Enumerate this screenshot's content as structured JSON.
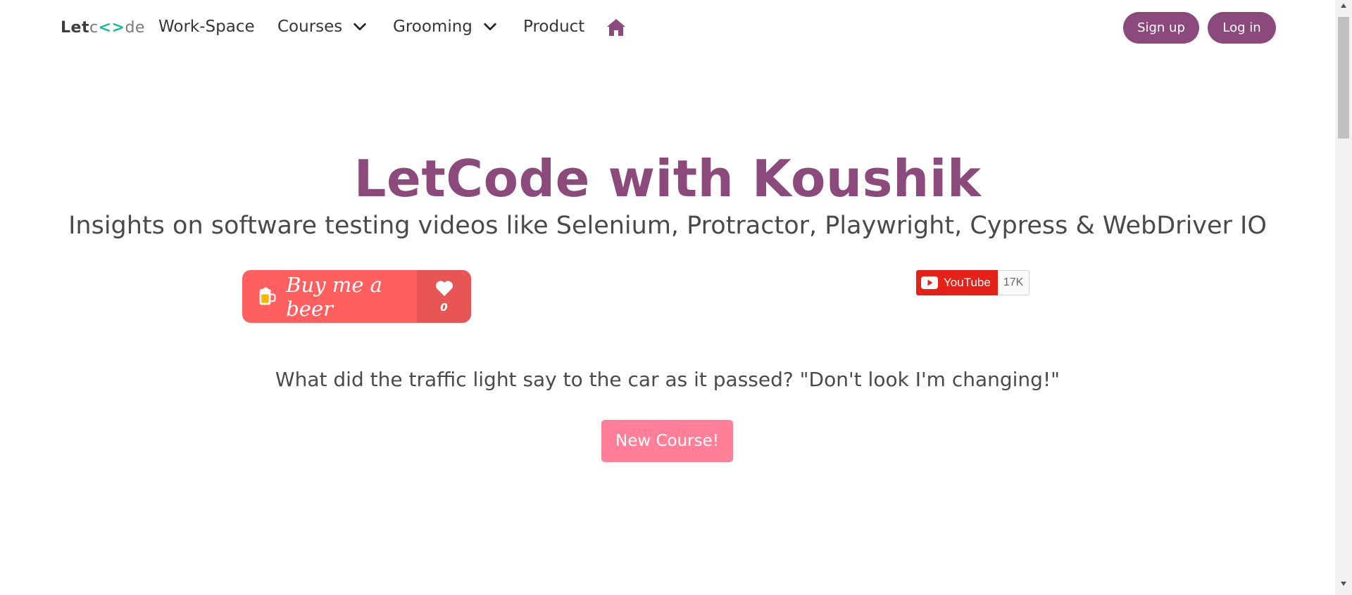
{
  "nav": {
    "logo": {
      "let": "Let",
      "code": "de",
      "brackets": "<>"
    },
    "items": [
      {
        "label": "Work-Space"
      },
      {
        "label": "Courses"
      },
      {
        "label": "Grooming"
      },
      {
        "label": "Product"
      }
    ],
    "home_icon": "home-icon",
    "signup_label": "Sign up",
    "login_label": "Log in"
  },
  "hero": {
    "title": "LetCode with Koushik",
    "subtitle": "Insights on software testing videos like Selenium, Protractor, Playwright, Cypress & WebDriver IO"
  },
  "beer_widget": {
    "label": "Buy me a beer",
    "count": "0",
    "icon": "beer-mug-icon"
  },
  "youtube_widget": {
    "label": "YouTube",
    "count": "17K",
    "icon": "youtube-play-icon"
  },
  "joke": "What did the traffic light say to the car as it passed? \"Don't look I'm changing!\"",
  "cta": {
    "label": "New Course!"
  },
  "colors": {
    "brand_purple": "#8b4a7b",
    "beer_red": "#ff5f5f",
    "beer_red_dark": "#e85555",
    "youtube_red": "#e62117",
    "cta_pink": "#ff7f98",
    "logo_accent": "#1abc9c"
  }
}
